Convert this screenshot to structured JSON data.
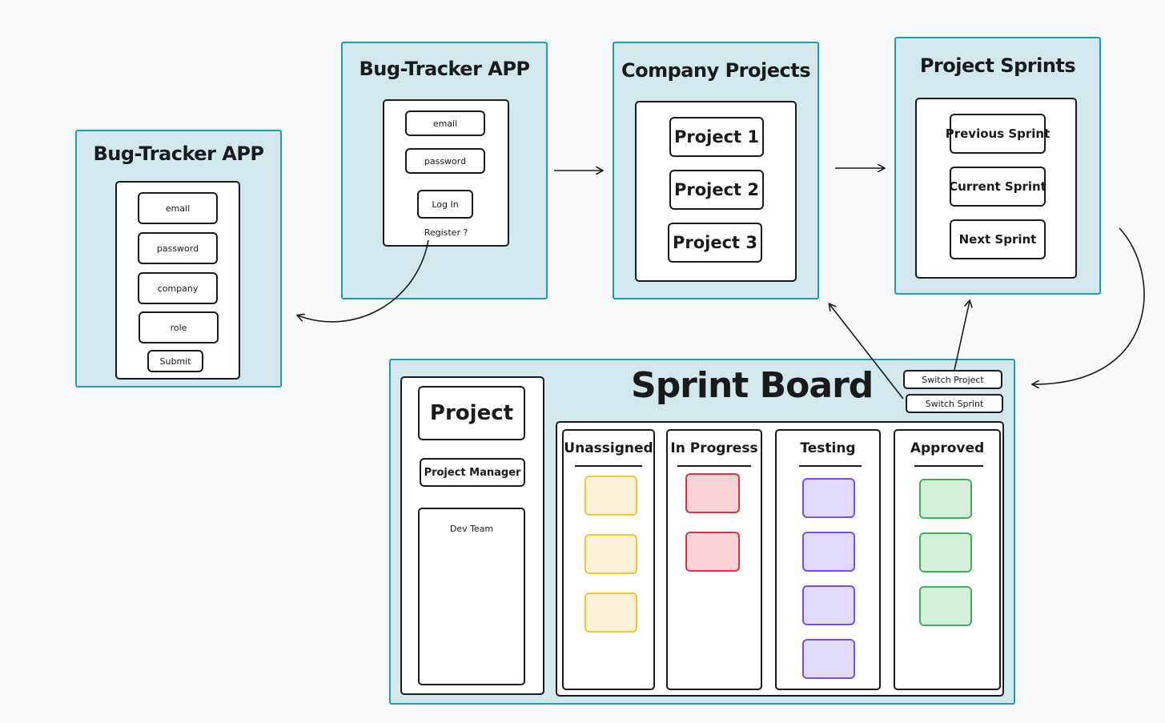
{
  "register_screen": {
    "title": "Bug-Tracker APP",
    "fields": [
      "email",
      "password",
      "company",
      "role"
    ],
    "submit_label": "Submit"
  },
  "login_screen": {
    "title": "Bug-Tracker APP",
    "email_label": "email",
    "password_label": "password",
    "login_label": "Log In",
    "register_link": "Register ?"
  },
  "projects_screen": {
    "title": "Company Projects",
    "projects": [
      "Project 1",
      "Project 2",
      "Project 3"
    ]
  },
  "sprints_screen": {
    "title": "Project Sprints",
    "sprints": [
      "Previous Sprint",
      "Current Sprint",
      "Next Sprint"
    ]
  },
  "sprint_board": {
    "title": "Sprint Board",
    "switch_project_label": "Switch Project",
    "switch_sprint_label": "Switch Sprint",
    "sidebar": {
      "project_label": "Project",
      "manager_label": "Project Manager",
      "dev_team_label": "Dev Team"
    },
    "columns": [
      {
        "name": "Unassigned",
        "card_count": 3,
        "fill": "#fcf1d6",
        "stroke": "#f2c531"
      },
      {
        "name": "In Progress",
        "card_count": 2,
        "fill": "#fad3d8",
        "stroke": "#e03140"
      },
      {
        "name": "Testing",
        "card_count": 4,
        "fill": "#e1dafb",
        "stroke": "#7b4ce6"
      },
      {
        "name": "Approved",
        "card_count": 3,
        "fill": "#d3efd9",
        "stroke": "#3fb05a"
      }
    ]
  },
  "colors": {
    "frame_fill": "#d3e8ec",
    "frame_border": "#1e9cb2",
    "ink": "#1a1a1a",
    "background": "#f8f9fb"
  }
}
